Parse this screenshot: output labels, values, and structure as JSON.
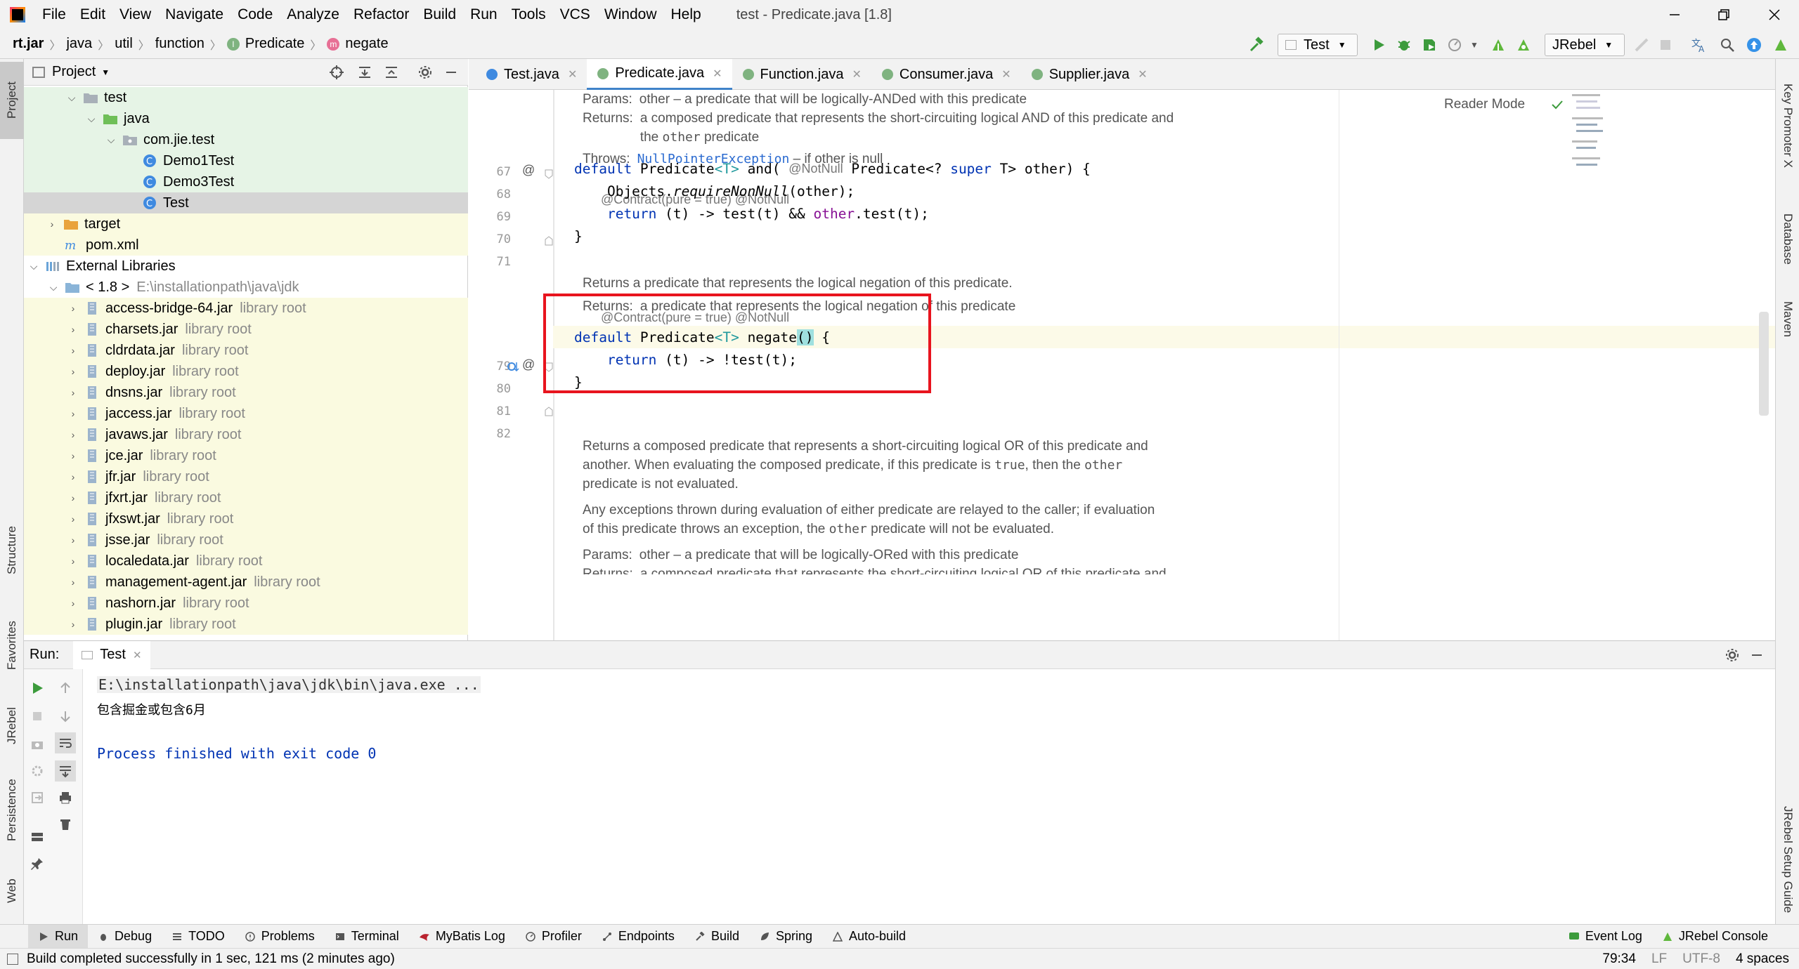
{
  "window": {
    "title": "test - Predicate.java [1.8]"
  },
  "menu": [
    "File",
    "Edit",
    "View",
    "Navigate",
    "Code",
    "Analyze",
    "Refactor",
    "Build",
    "Run",
    "Tools",
    "VCS",
    "Window",
    "Help"
  ],
  "breadcrumb": {
    "jar": "rt.jar",
    "p1": "java",
    "p2": "util",
    "p3": "function",
    "cls": "Predicate",
    "method": "negate"
  },
  "toolbar": {
    "run_config": "Test",
    "jrebel": "JRebel"
  },
  "project": {
    "title": "Project",
    "rows": [
      {
        "label": "test"
      },
      {
        "label": "java"
      },
      {
        "label": "com.jie.test"
      },
      {
        "label": "Demo1Test"
      },
      {
        "label": "Demo3Test"
      },
      {
        "label": "Test"
      },
      {
        "label": "target"
      },
      {
        "label": "pom.xml"
      },
      {
        "label": "External Libraries"
      },
      {
        "label": "< 1.8 >",
        "path": "E:\\installationpath\\java\\jdk"
      },
      {
        "label": "access-bridge-64.jar",
        "lib": "library root"
      },
      {
        "label": "charsets.jar",
        "lib": "library root"
      },
      {
        "label": "cldrdata.jar",
        "lib": "library root"
      },
      {
        "label": "deploy.jar",
        "lib": "library root"
      },
      {
        "label": "dnsns.jar",
        "lib": "library root"
      },
      {
        "label": "jaccess.jar",
        "lib": "library root"
      },
      {
        "label": "javaws.jar",
        "lib": "library root"
      },
      {
        "label": "jce.jar",
        "lib": "library root"
      },
      {
        "label": "jfr.jar",
        "lib": "library root"
      },
      {
        "label": "jfxrt.jar",
        "lib": "library root"
      },
      {
        "label": "jfxswt.jar",
        "lib": "library root"
      },
      {
        "label": "jsse.jar",
        "lib": "library root"
      },
      {
        "label": "localedata.jar",
        "lib": "library root"
      },
      {
        "label": "management-agent.jar",
        "lib": "library root"
      },
      {
        "label": "nashorn.jar",
        "lib": "library root"
      },
      {
        "label": "plugin.jar",
        "lib": "library root"
      }
    ]
  },
  "editor": {
    "tabs": [
      "Test.java",
      "Predicate.java",
      "Function.java",
      "Consumer.java",
      "Supplier.java"
    ],
    "reader_mode": "Reader Mode",
    "doc1": {
      "params_label": "Params:",
      "params_text": "other – a predicate that will be logically-ANDed with this predicate",
      "returns_label": "Returns:",
      "returns_text1": "a composed predicate that represents the short-circuiting logical AND of this predicate and",
      "returns_text2a": "the ",
      "returns_mono": "other",
      "returns_text2b": " predicate",
      "throws_label": "Throws:",
      "throws_link": "NullPointerException",
      "throws_text": " – if other is null"
    },
    "anno1": "@Contract(pure = true)   @NotNull",
    "line67": "67",
    "line68": "68",
    "line69": "69",
    "line70": "70",
    "line71": "71",
    "c67_kw": "default",
    "c67_a": " Predicate",
    "c67_t": "<T>",
    "c67_b": " and( ",
    "c67_ann": "@NotNull",
    "c67_c": " Predicate<? ",
    "c67_super": "super",
    "c67_d": " T> other) {",
    "c68_a": "    Objects.",
    "c68_m": "requireNonNull",
    "c68_b": "(other);",
    "c69_kw": "    return",
    "c69_a": " (t) -> test(t) && ",
    "c69_f": "other",
    "c69_b": ".test(t);",
    "c70": "}",
    "doc2": {
      "line1": "Returns a predicate that represents the logical negation of this predicate.",
      "returns_label": "Returns:",
      "returns_text": "a predicate that represents the logical negation of this predicate"
    },
    "anno2": "@Contract(pure = true)   @NotNull",
    "line79": "79",
    "line80": "80",
    "line81": "81",
    "line82": "82",
    "c79_kw": "default",
    "c79_a": " Predicate",
    "c79_t": "<T>",
    "c79_b": " negate",
    "c79_p": "()",
    "c79_c": " {",
    "c80_kw": "    return",
    "c80_a": " (t) -> !test(t);",
    "c81": "}",
    "doc3": {
      "p1a": "Returns a composed predicate that represents a short-circuiting logical OR of this predicate and",
      "p1b_a": "another. When evaluating the composed predicate, if this predicate is ",
      "p1b_m1": "true",
      "p1b_b": ", then the ",
      "p1b_m2": "other",
      "p1c": "predicate is not evaluated.",
      "p2a": "Any exceptions thrown during evaluation of either predicate are relayed to the caller; if evaluation",
      "p2b_a": "of this predicate throws an exception, the ",
      "p2b_m": "other",
      "p2b_b": " predicate will not be evaluated.",
      "params_label": "Params:",
      "params_text": "other – a predicate that will be logically-ORed with this predicate",
      "returns_label": "Returns:",
      "returns_text": "a composed predicate that represents the short-circuiting logical OR of this predicate and"
    }
  },
  "run": {
    "label": "Run:",
    "tab": "Test",
    "console": [
      "E:\\installationpath\\java\\jdk\\bin\\java.exe ...",
      "包含掘金或包含6月",
      "",
      "Process finished with exit code 0"
    ]
  },
  "left_stripe": {
    "project": "Project",
    "structure": "Structure",
    "favorites": "Favorites",
    "jrebel": "JRebel",
    "persistence": "Persistence",
    "web": "Web"
  },
  "right_stripe": {
    "key_promoter": "Key Promoter X",
    "database": "Database",
    "maven": "Maven",
    "jrebel_guide": "JRebel Setup Guide"
  },
  "bottom_tabs": [
    "Run",
    "Debug",
    "TODO",
    "Problems",
    "Terminal",
    "MyBatis Log",
    "Profiler",
    "Endpoints",
    "Build",
    "Spring",
    "Auto-build"
  ],
  "bottom_right": {
    "event_log": "Event Log",
    "jrebel_console": "JRebel Console"
  },
  "status": {
    "message": "Build completed successfully in 1 sec, 121 ms (2 minutes ago)",
    "position": "79:34",
    "line_sep": "LF",
    "encoding": "UTF-8",
    "indent": "4 spaces"
  },
  "colors": {
    "highlight_box": "#e8141e",
    "tree_bg": "#fafae0",
    "tree_green": "#e6f4e6",
    "accent": "#4083c9"
  }
}
